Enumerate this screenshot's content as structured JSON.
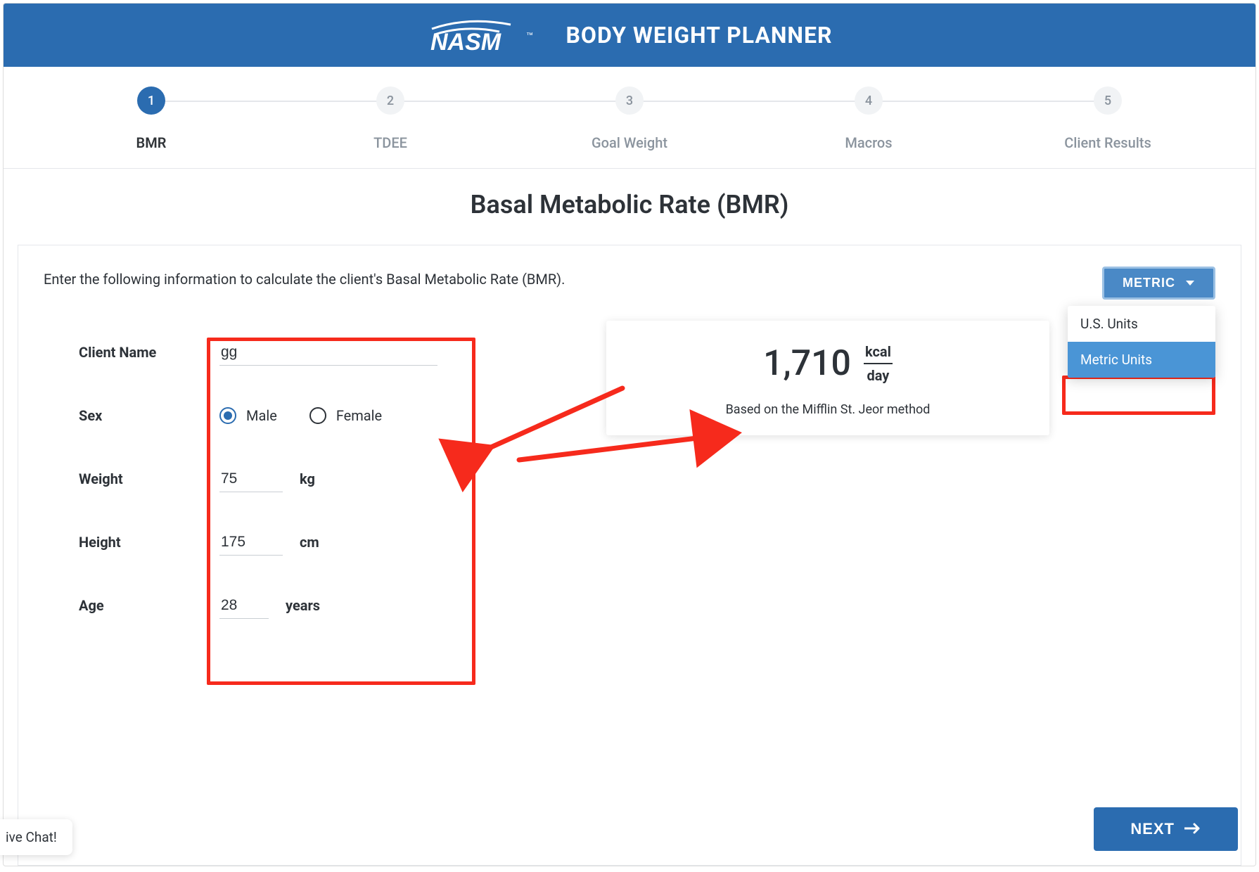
{
  "header": {
    "app_title": "BODY WEIGHT PLANNER",
    "brand": "NASM"
  },
  "stepper": {
    "steps": [
      {
        "num": "1",
        "label": "BMR",
        "active": true
      },
      {
        "num": "2",
        "label": "TDEE",
        "active": false
      },
      {
        "num": "3",
        "label": "Goal Weight",
        "active": false
      },
      {
        "num": "4",
        "label": "Macros",
        "active": false
      },
      {
        "num": "5",
        "label": "Client Results",
        "active": false
      }
    ]
  },
  "page_title": "Basal Metabolic Rate (BMR)",
  "instruction": "Enter the following information to calculate the client's Basal Metabolic Rate (BMR).",
  "units": {
    "button_label": "METRIC",
    "options": [
      {
        "label": "U.S. Units",
        "selected": false
      },
      {
        "label": "Metric Units",
        "selected": true
      }
    ]
  },
  "form": {
    "client_name": {
      "label": "Client Name",
      "value": "gg"
    },
    "sex": {
      "label": "Sex",
      "options": [
        {
          "label": "Male",
          "checked": true
        },
        {
          "label": "Female",
          "checked": false
        }
      ]
    },
    "weight": {
      "label": "Weight",
      "value": "75",
      "unit": "kg"
    },
    "height": {
      "label": "Height",
      "value": "175",
      "unit": "cm"
    },
    "age": {
      "label": "Age",
      "value": "28",
      "unit": "years"
    }
  },
  "result": {
    "value": "1,710",
    "unit_top": "kcal",
    "unit_bottom": "day",
    "method": "Based on the Mifflin St. Jeor method"
  },
  "next_label": "NEXT",
  "chat_label": "ive Chat!"
}
